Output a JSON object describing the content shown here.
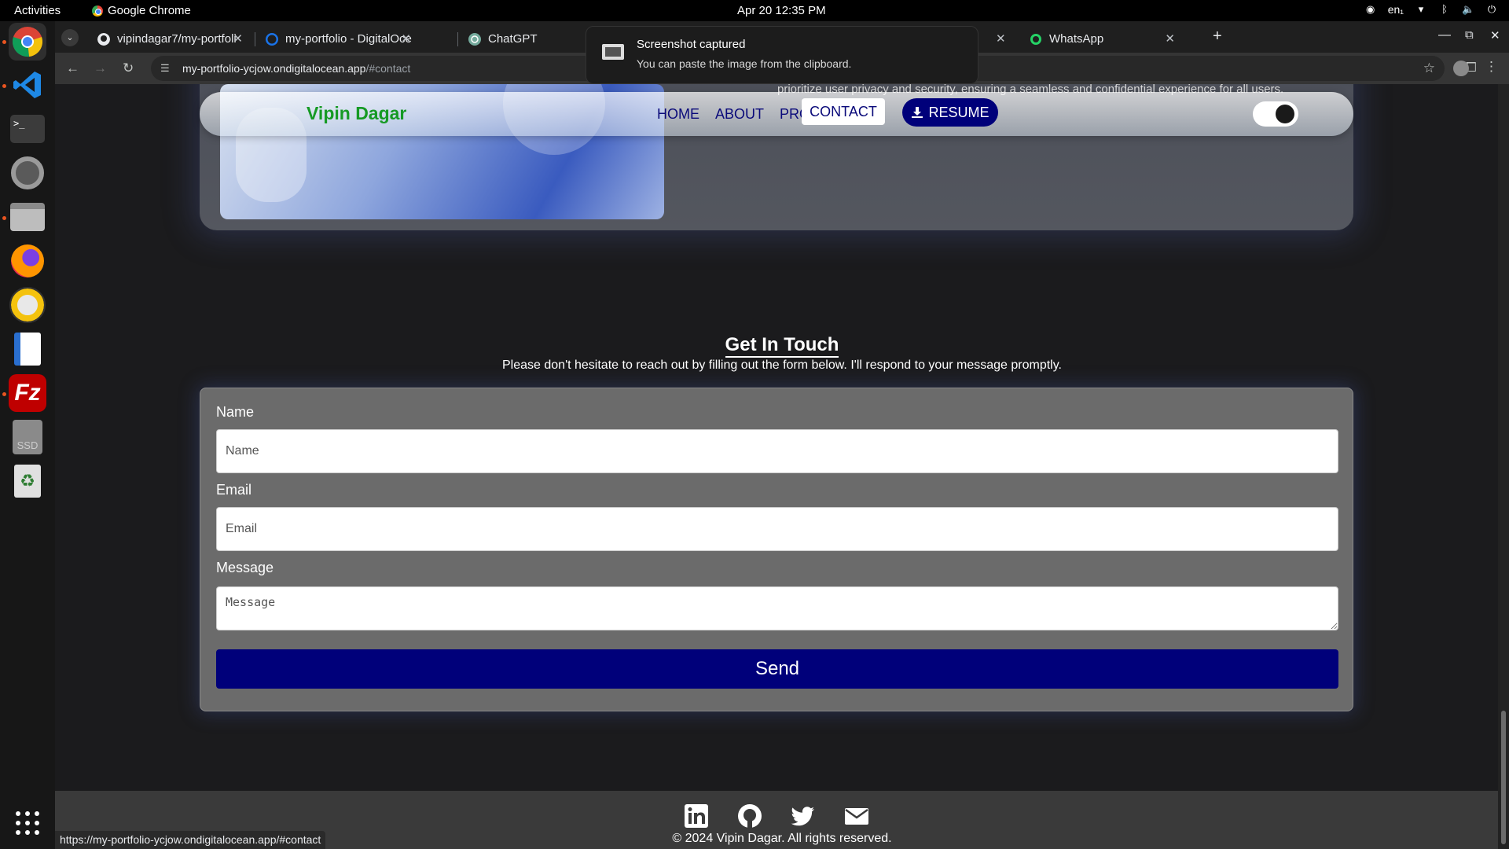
{
  "system": {
    "activities": "Activities",
    "app_name": "Google Chrome",
    "clock": "Apr 20  12:35 PM",
    "lang": "en₁"
  },
  "dock": {
    "items": [
      "chrome",
      "vscode",
      "terminal",
      "settings",
      "files",
      "firefox",
      "rhythmbox",
      "writer",
      "filezilla",
      "ssd",
      "trash",
      "app-grid"
    ],
    "ssd_label": "SSD"
  },
  "tabs": [
    {
      "title": "vipindagar7/my-portfoli",
      "icon": "github-icon"
    },
    {
      "title": "my-portfolio - DigitalOce",
      "icon": "digitalocean-icon"
    },
    {
      "title": "ChatGPT",
      "icon": "chatgpt-icon"
    },
    {
      "title": "WhatsApp",
      "icon": "whatsapp-icon"
    }
  ],
  "browser": {
    "url_host": "my-portfolio-ycjow.ondigitalocean.app",
    "url_path": "/#contact",
    "status_url": "https://my-portfolio-ycjow.ondigitalocean.app/#contact"
  },
  "notification": {
    "title": "Screenshot captured",
    "body": "You can paste the image from the clipboard."
  },
  "site": {
    "brand": "Vipin Dagar",
    "nav": {
      "home": "HOME",
      "about": "ABOUT",
      "project": "PROJECT",
      "contact": "CONTACT",
      "resume": "RESUME"
    },
    "project_desc": "prioritize user privacy and security, ensuring a seamless and confidential experience for all users.",
    "contact": {
      "title": "Get In Touch",
      "subtitle": "Please don't hesitate to reach out by filling out the form below. I'll respond to your message promptly.",
      "name_label": "Name",
      "name_placeholder": "Name",
      "email_label": "Email",
      "email_placeholder": "Email",
      "message_label": "Message",
      "message_placeholder": "Message",
      "send": "Send"
    },
    "footer": {
      "social": [
        "linkedin-icon",
        "github-icon",
        "twitter-icon",
        "email-icon"
      ],
      "copyright": "© 2024 Vipin Dagar. All rights reserved."
    }
  },
  "colors": {
    "brand_green": "#169a24",
    "nav_blue": "#0a0a7a",
    "button_navy": "#00007a"
  }
}
